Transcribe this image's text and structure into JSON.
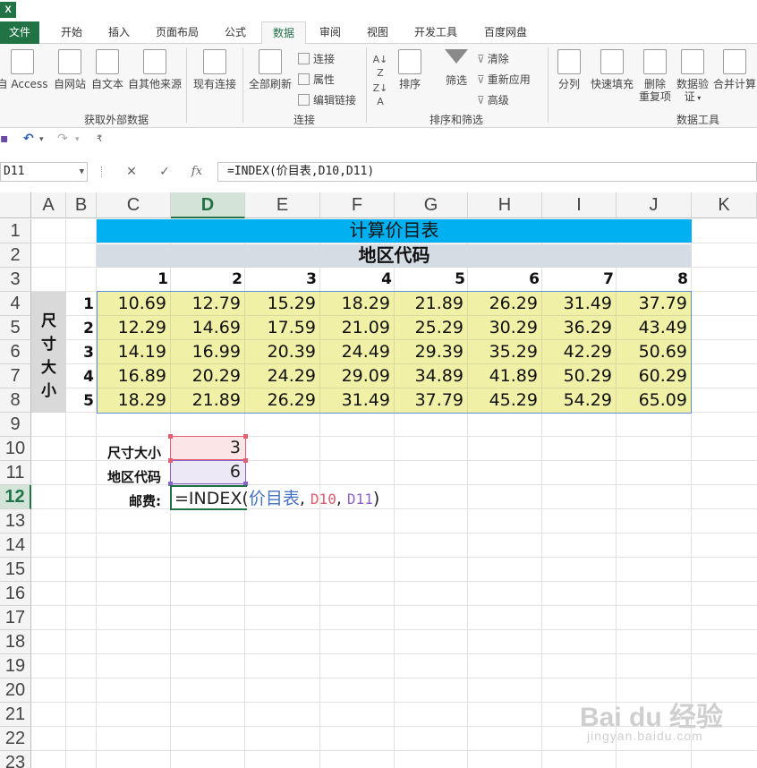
{
  "app": {
    "logo_text": "X"
  },
  "ribbon_tabs": [
    {
      "label": "文件"
    },
    {
      "label": "开始"
    },
    {
      "label": "插入"
    },
    {
      "label": "页面布局"
    },
    {
      "label": "公式"
    },
    {
      "label": "数据"
    },
    {
      "label": "审阅"
    },
    {
      "label": "视图"
    },
    {
      "label": "开发工具"
    },
    {
      "label": "百度网盘"
    }
  ],
  "active_tab": "数据",
  "ribbon": {
    "get_external": {
      "buttons": [
        "自 Access",
        "自网站",
        "自文本",
        "自其他来源",
        "现有连接"
      ],
      "label": "获取外部数据"
    },
    "connections": {
      "refresh_all": "全部刷新",
      "small": [
        "连接",
        "属性",
        "编辑链接"
      ],
      "label": "连接"
    },
    "sort_filter": {
      "sort": "排序",
      "filter": "筛选",
      "small": [
        "清除",
        "重新应用",
        "高级"
      ],
      "label": "排序和筛选"
    },
    "data_tools": {
      "split": "分列",
      "flash_fill": "快速填充",
      "remove_dup": [
        "删除",
        "重复项"
      ],
      "validate": [
        "数据验",
        "证"
      ],
      "consolidate": "合并计算",
      "label": "数据工具"
    }
  },
  "qat": {
    "save": "▪",
    "undo": "↶",
    "undo_dd": "▾",
    "redo": "↷",
    "redo_dd": "▾",
    "customize": "₹"
  },
  "formula_bar": {
    "namebox": "D11",
    "cancel": "✕",
    "enter": "✓",
    "fx": "fx",
    "formula": "=INDEX(价目表,D10,D11)"
  },
  "columns": [
    "A",
    "B",
    "C",
    "D",
    "E",
    "F",
    "G",
    "H",
    "I",
    "J",
    "K"
  ],
  "rows": [
    "1",
    "2",
    "3",
    "4",
    "5",
    "6",
    "7",
    "8",
    "9",
    "10",
    "11",
    "12",
    "13",
    "14",
    "15",
    "16",
    "17",
    "18",
    "19",
    "20",
    "21",
    "22",
    "23"
  ],
  "selected_col": "D",
  "selected_row": "12",
  "sheet": {
    "title": "计算价目表",
    "region_header": "地区代码",
    "size_header": [
      "尺",
      "寸",
      "大",
      "小"
    ],
    "region_codes": [
      "1",
      "2",
      "3",
      "4",
      "5",
      "6",
      "7",
      "8"
    ],
    "size_codes": [
      "1",
      "2",
      "3",
      "4",
      "5"
    ],
    "table": [
      [
        "10.69",
        "12.79",
        "15.29",
        "18.29",
        "21.89",
        "26.29",
        "31.49",
        "37.79"
      ],
      [
        "12.29",
        "14.69",
        "17.59",
        "21.09",
        "25.29",
        "30.29",
        "36.29",
        "43.49"
      ],
      [
        "14.19",
        "16.99",
        "20.39",
        "24.49",
        "29.39",
        "35.29",
        "42.29",
        "50.69"
      ],
      [
        "16.89",
        "20.29",
        "24.29",
        "29.09",
        "34.89",
        "41.89",
        "50.29",
        "60.29"
      ],
      [
        "18.29",
        "21.89",
        "26.29",
        "31.49",
        "37.79",
        "45.29",
        "54.29",
        "65.09"
      ]
    ],
    "label_size": "尺寸大小",
    "label_region": "地区代码",
    "label_postage": "邮费:",
    "value_size": "3",
    "value_region": "6",
    "edit_prefix": "=INDEX(",
    "edit_name": "价目表",
    "edit_comma1": ", ",
    "edit_ref1": "D10",
    "edit_comma2": ", ",
    "edit_ref2": "D11",
    "edit_close": ")"
  },
  "watermark": {
    "brand": "Bai du 经验",
    "domain": "jingyan.baidu.com"
  }
}
